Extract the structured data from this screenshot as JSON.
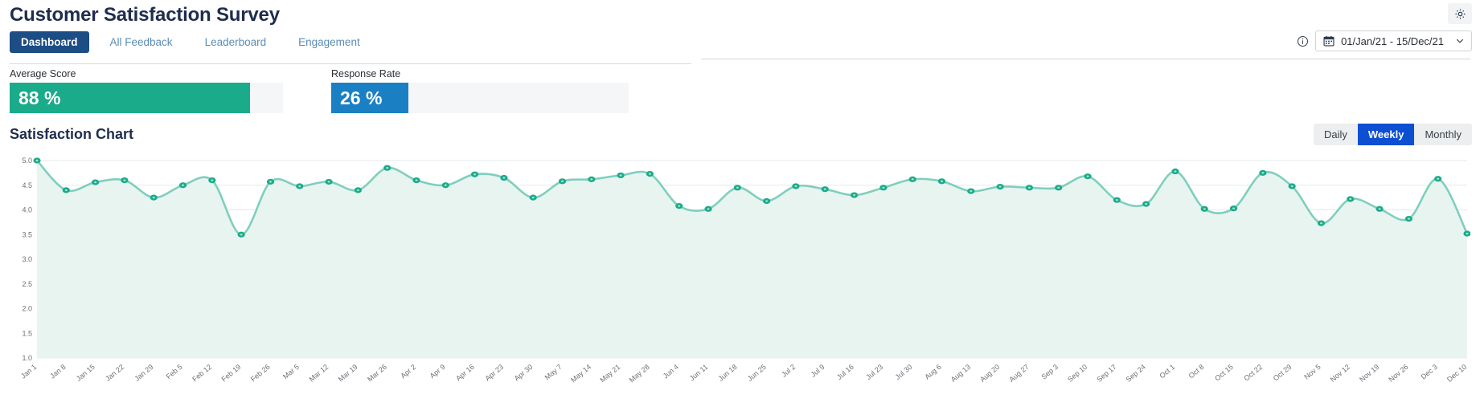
{
  "header": {
    "title": "Customer Satisfaction Survey",
    "gear_icon": "gear-icon"
  },
  "tabs": [
    {
      "label": "Dashboard",
      "active": true
    },
    {
      "label": "All Feedback",
      "active": false
    },
    {
      "label": "Leaderboard",
      "active": false
    },
    {
      "label": "Engagement",
      "active": false
    }
  ],
  "date_range": {
    "info_icon": "info-circle-icon",
    "calendar_icon": "calendar-icon",
    "value": "01/Jan/21 - 15/Dec/21",
    "chevron_icon": "chevron-down-icon"
  },
  "kpis": [
    {
      "label": "Average Score",
      "value": "88 %",
      "percent": 88,
      "color": "#1aab8b"
    },
    {
      "label": "Response Rate",
      "value": "26 %",
      "percent": 26,
      "color": "#1b7fc4"
    }
  ],
  "chart_section": {
    "title": "Satisfaction Chart",
    "granularity": [
      {
        "label": "Daily",
        "active": false
      },
      {
        "label": "Weekly",
        "active": true
      },
      {
        "label": "Monthly",
        "active": false
      }
    ]
  },
  "chart_data": {
    "type": "line",
    "title": "Satisfaction Chart",
    "xlabel": "",
    "ylabel": "",
    "ylim": [
      1.0,
      5.0
    ],
    "ytick_labels": [
      "1.0",
      "1.5",
      "2.0",
      "2.5",
      "3.0",
      "3.5",
      "4.0",
      "4.5",
      "5.0"
    ],
    "yticks": [
      1.0,
      1.5,
      2.0,
      2.5,
      3.0,
      3.5,
      4.0,
      4.5,
      5.0
    ],
    "grid": true,
    "legend": "none",
    "area_fill": true,
    "line_color": "#7fcfbd",
    "marker_color": "#1aab8b",
    "fill_color": "#e8f4f0",
    "categories": [
      "Jan 1",
      "Jan 8",
      "Jan 15",
      "Jan 22",
      "Jan 29",
      "Feb 5",
      "Feb 12",
      "Feb 19",
      "Feb 26",
      "Mar 5",
      "Mar 12",
      "Mar 19",
      "Mar 26",
      "Apr 2",
      "Apr 9",
      "Apr 16",
      "Apr 23",
      "Apr 30",
      "May 7",
      "May 14",
      "May 21",
      "May 28",
      "Jun 4",
      "Jun 11",
      "Jun 18",
      "Jun 25",
      "Jul 2",
      "Jul 9",
      "Jul 16",
      "Jul 23",
      "Jul 30",
      "Aug 6",
      "Aug 13",
      "Aug 20",
      "Aug 27",
      "Sep 3",
      "Sep 10",
      "Sep 17",
      "Sep 24",
      "Oct 1",
      "Oct 8",
      "Oct 15",
      "Oct 22",
      "Oct 29",
      "Nov 5",
      "Nov 12",
      "Nov 19",
      "Nov 26",
      "Dec 3",
      "Dec 10"
    ],
    "values": [
      5.0,
      4.4,
      4.56,
      4.6,
      4.25,
      4.5,
      4.6,
      3.5,
      4.57,
      4.48,
      4.57,
      4.4,
      4.85,
      4.6,
      4.5,
      4.72,
      4.65,
      4.25,
      4.58,
      4.62,
      4.7,
      4.73,
      4.08,
      4.02,
      4.45,
      4.18,
      4.48,
      4.42,
      4.3,
      4.45,
      4.62,
      4.58,
      4.38,
      4.47,
      4.45,
      4.45,
      4.68,
      4.2,
      4.12,
      4.78,
      4.02,
      4.03,
      4.75,
      4.48,
      3.73,
      4.22,
      4.02,
      3.82,
      4.63,
      3.52
    ],
    "series": [
      {
        "name": "Satisfaction",
        "values": [
          5.0,
          4.4,
          4.56,
          4.6,
          4.25,
          4.5,
          4.6,
          3.5,
          4.57,
          4.48,
          4.57,
          4.4,
          4.85,
          4.6,
          4.5,
          4.72,
          4.65,
          4.25,
          4.58,
          4.62,
          4.7,
          4.73,
          4.08,
          4.02,
          4.45,
          4.18,
          4.48,
          4.42,
          4.3,
          4.45,
          4.62,
          4.58,
          4.38,
          4.47,
          4.45,
          4.45,
          4.68,
          4.2,
          4.12,
          4.78,
          4.02,
          4.03,
          4.75,
          4.48,
          3.73,
          4.22,
          4.02,
          3.82,
          4.63,
          3.52
        ]
      }
    ]
  }
}
